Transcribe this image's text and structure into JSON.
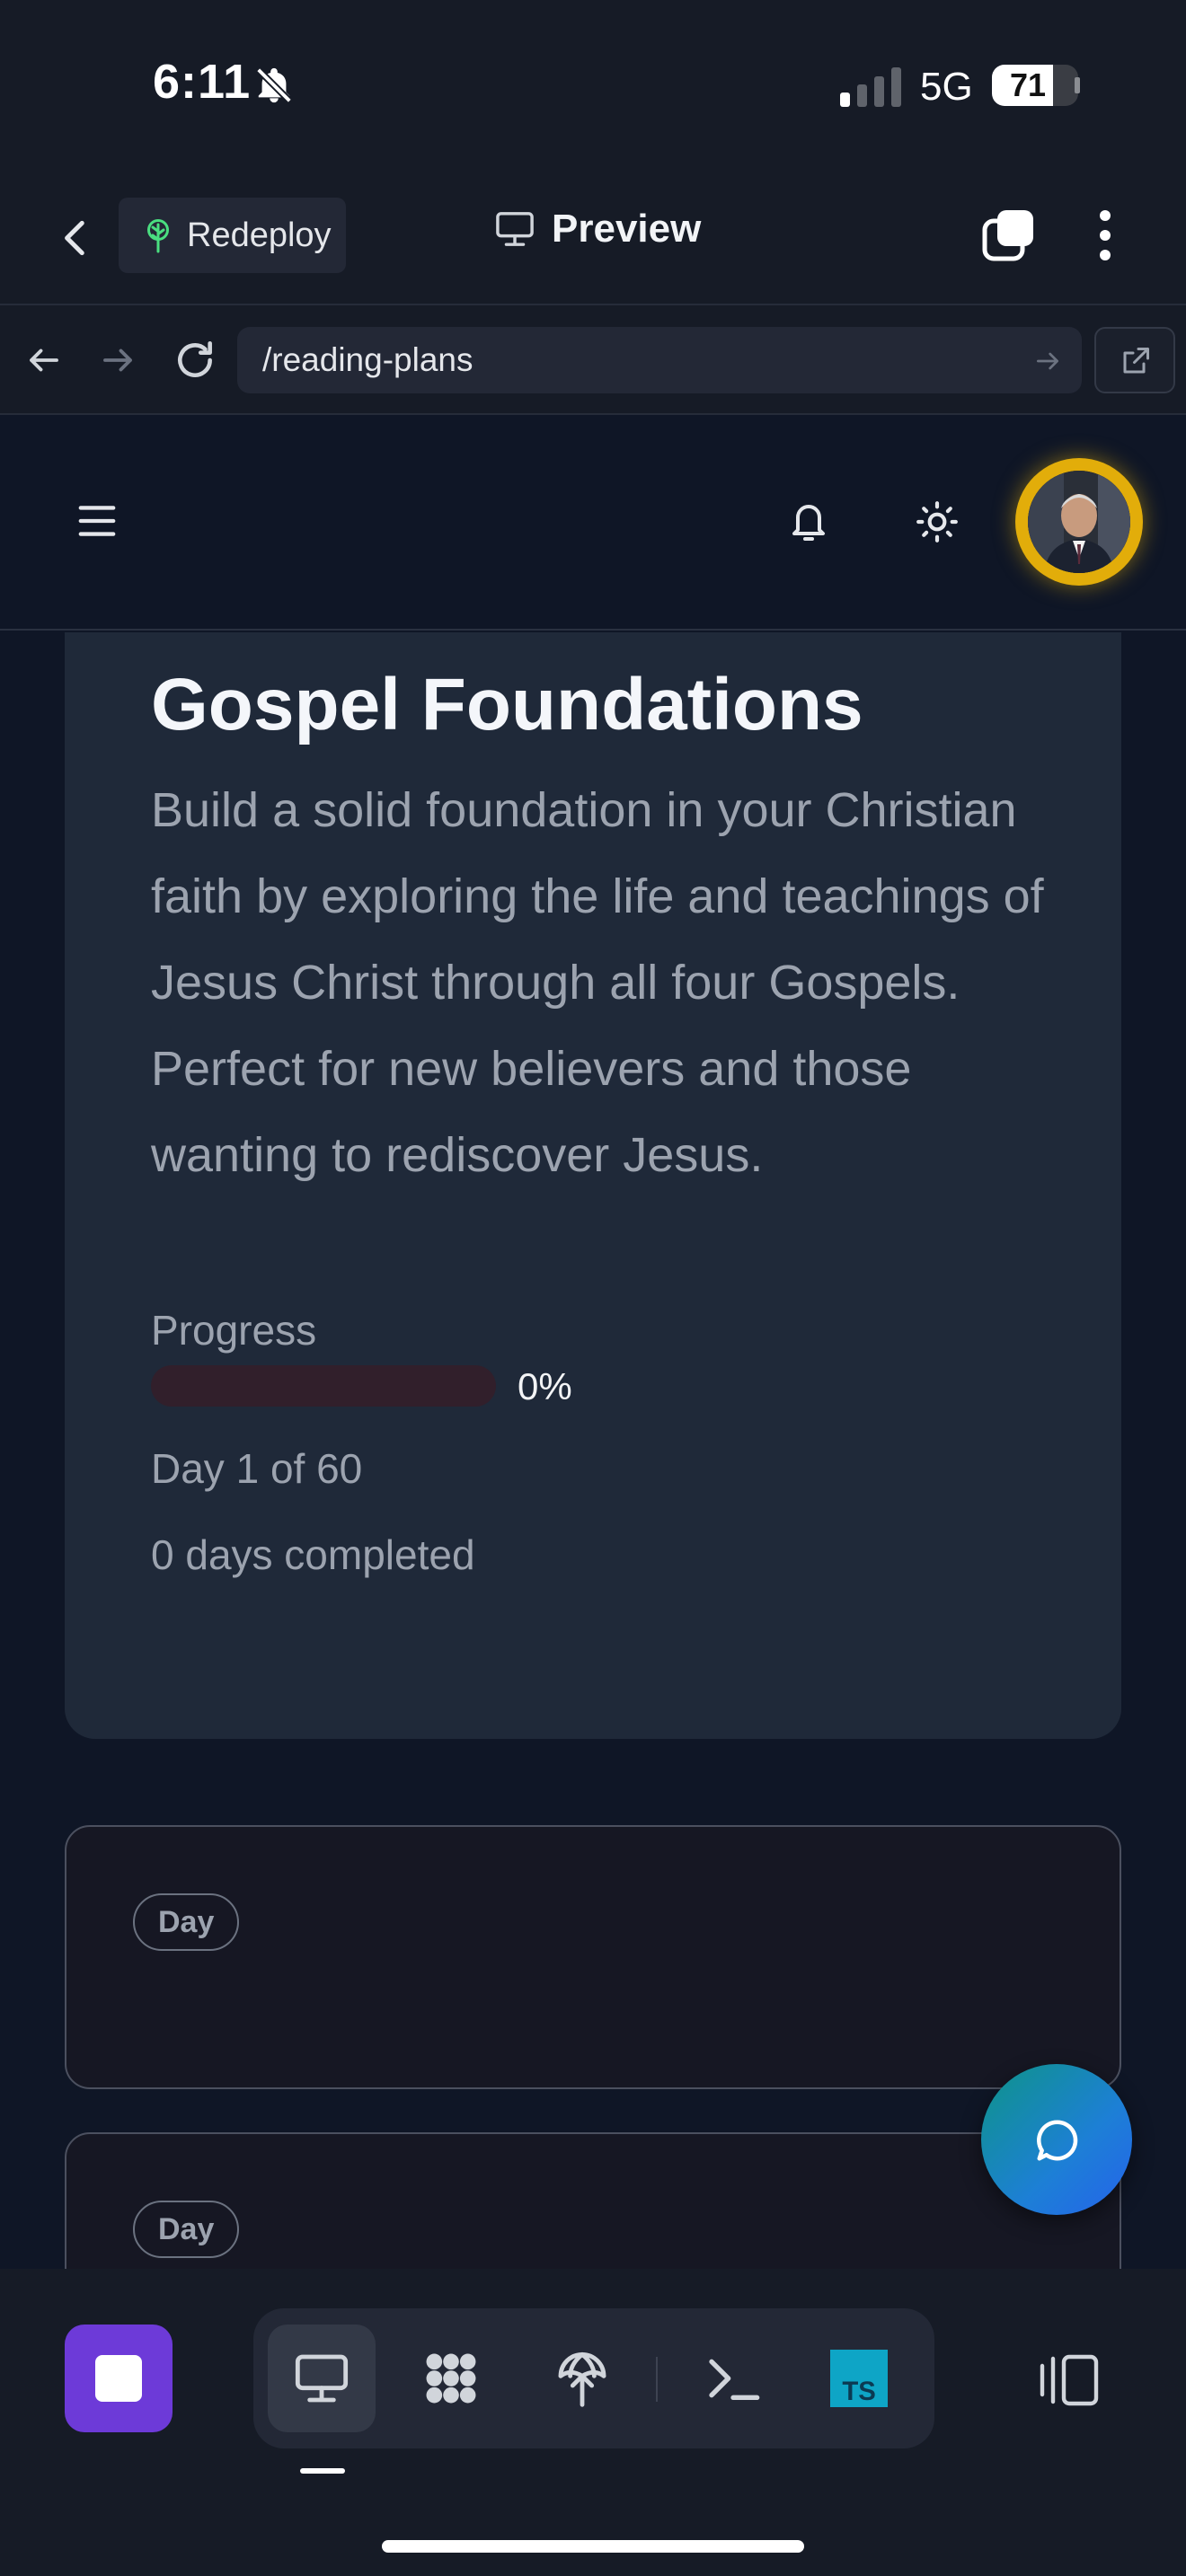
{
  "status_bar": {
    "time": "6:11",
    "network": "5G",
    "battery": "71",
    "battery_level": 0.71
  },
  "app_header": {
    "redeploy_label": "Redeploy",
    "preview_label": "Preview"
  },
  "browser": {
    "url": "/reading-plans"
  },
  "plan": {
    "title": "Gospel Foundations",
    "description": "Build a solid foundation in your Christian faith by exploring the life and teachings of Jesus Christ through all four Gospels. Perfect for new believers and those wanting to rediscover Jesus.",
    "progress_label": "Progress",
    "progress_value": 0,
    "progress_text": "0%",
    "day_of": "Day 1 of 60",
    "days_completed": "0 days completed"
  },
  "day_cards": [
    {
      "badge": "Day"
    },
    {
      "badge": "Day"
    }
  ],
  "colors": {
    "accent_purple": "#6d3ad8",
    "avatar_ring": "#e2ad0a",
    "progress_fill": "#dc2626",
    "chat_gradient_start": "#0e9488",
    "chat_gradient_end": "#2563eb"
  },
  "icons": {
    "back": "chevron-left-icon",
    "redeploy": "redeploy-tree-icon",
    "preview": "monitor-icon",
    "tabs": "tabs-icon",
    "more": "kebab-icon",
    "reload": "reload-icon",
    "external": "open-external-icon",
    "menu": "hamburger-icon",
    "notifications": "bell-icon",
    "theme": "sun-icon",
    "chat": "chat-bubble-icon",
    "stop": "stop-icon",
    "terminal": "terminal-icon",
    "typescript": "typescript-icon"
  }
}
